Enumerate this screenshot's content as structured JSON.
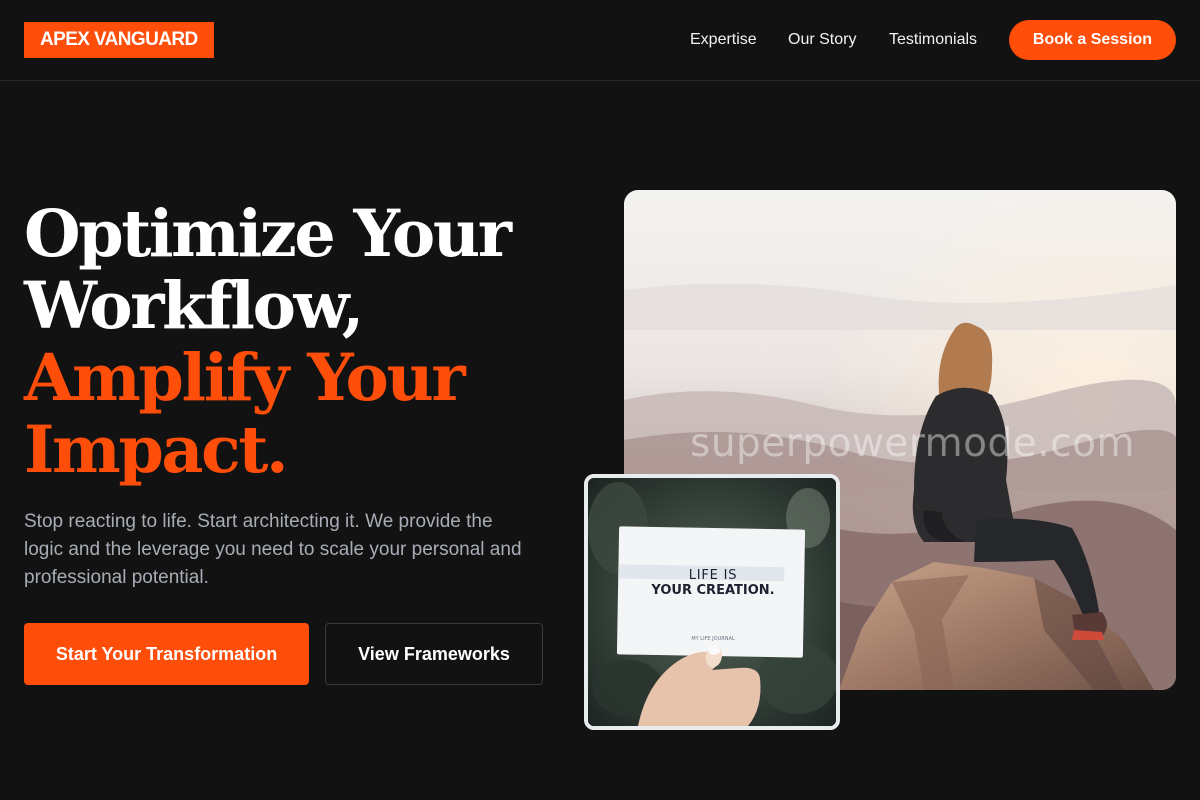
{
  "brand": {
    "logo": "APEX VANGUARD"
  },
  "nav": {
    "links": [
      "Expertise",
      "Our Story",
      "Testimonials"
    ],
    "cta": "Book a Session"
  },
  "hero": {
    "headline_line1": "Optimize Your",
    "headline_line2": "Workflow,",
    "headline_accent_line1": "Amplify Your",
    "headline_accent_line2": "Impact.",
    "subcopy": "Stop reacting to life. Start architecting it. We provide the logic and the leverage you need to scale your personal and professional potential.",
    "primary_button": "Start Your Transformation",
    "secondary_button": "View Frameworks"
  },
  "media": {
    "watermark": "superpowermode.com",
    "card_line1": "LIFE IS",
    "card_line2": "YOUR CREATION.",
    "card_footer": "MY LIFE JOURNAL"
  },
  "colors": {
    "accent": "#ff4d0a",
    "background": "#121212",
    "muted_text": "#a8adb5"
  }
}
